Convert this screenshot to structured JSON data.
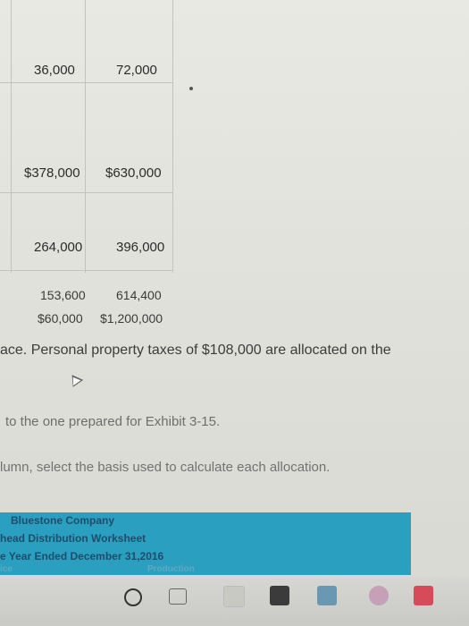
{
  "table": {
    "row1": {
      "a": "36,000",
      "b": "72,000"
    },
    "row2": {
      "a": "$378,000",
      "b": "$630,000"
    },
    "row3": {
      "a": "264,000",
      "b": "396,000"
    },
    "row4": {
      "a": "153,600",
      "b": "614,400"
    },
    "row5": {
      "a": "$60,000",
      "b": "$1,200,000"
    }
  },
  "text": {
    "personal_property": "ace. Personal property taxes of $108,000 are allocated on the",
    "prepared_for": "to the one prepared for Exhibit 3-15.",
    "select_basis": "lumn, select the basis used to calculate each allocation."
  },
  "banner": {
    "company": "Bluestone Company",
    "worksheet": "head Distribution Worksheet",
    "period": "e Year Ended December 31,2016",
    "left_cut": "ice",
    "production": "Production"
  },
  "colors": {
    "banner": "#2a9fbf",
    "banner_text": "#1d4e6a"
  },
  "taskbar": {
    "icons": [
      "search-circle-icon",
      "task-view-icon",
      "window-icon",
      "store-icon",
      "camera-icon",
      "browser-icon",
      "app-n-icon"
    ]
  }
}
